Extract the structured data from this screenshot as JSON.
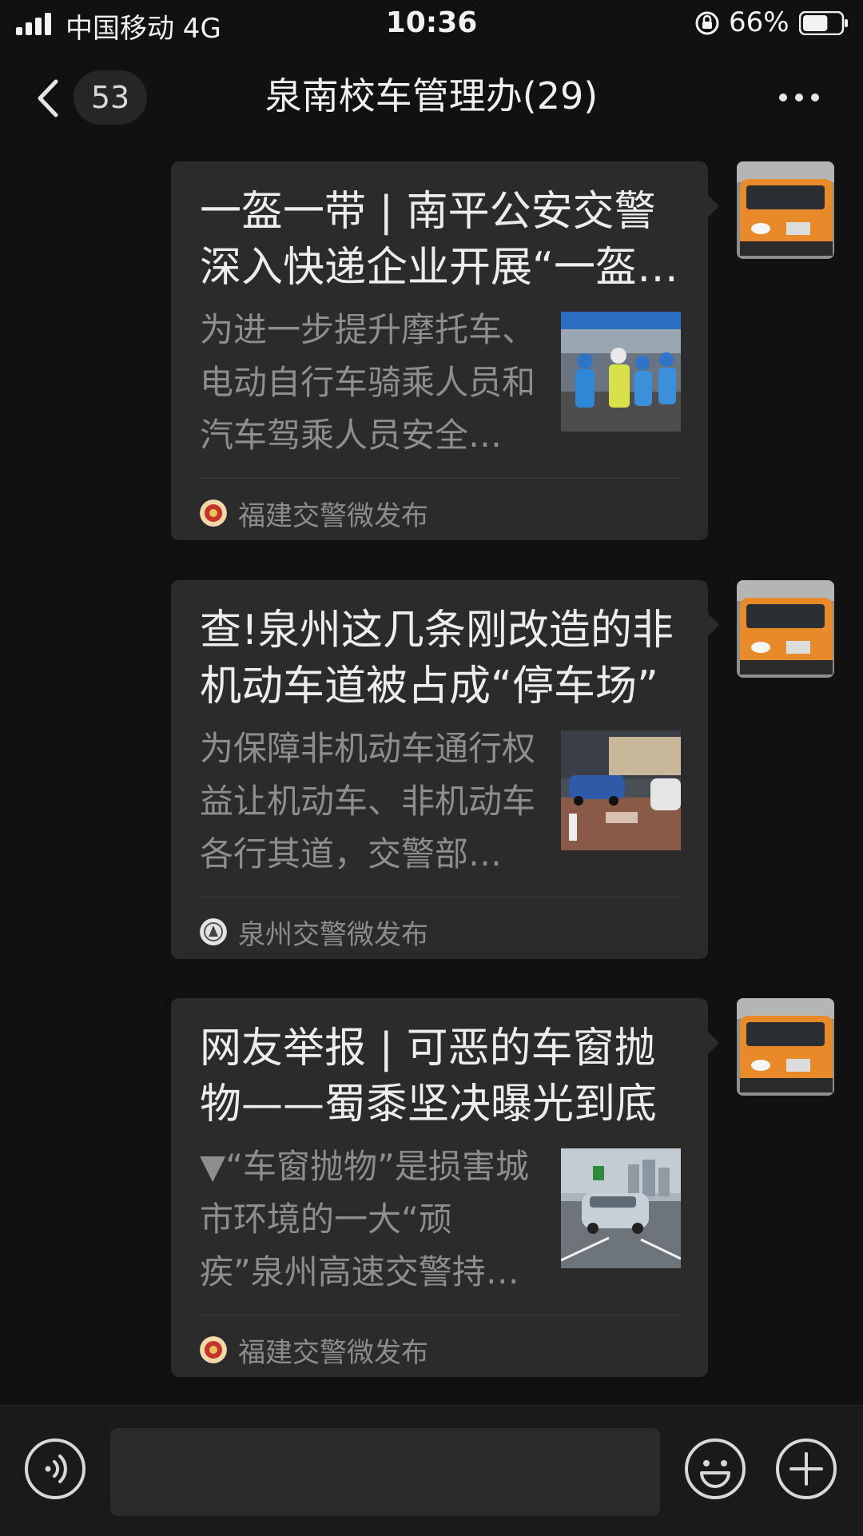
{
  "status_bar": {
    "carrier": "中国移动  4G",
    "time": "10:36",
    "battery_percent": "66%",
    "battery_level": 0.66
  },
  "nav": {
    "unread_count": "53",
    "title": "泉南校车管理办(29)"
  },
  "messages": [
    {
      "title": "一盔一带 | 南平公安交警深入快递企业开展“一盔一带”安全守护行动",
      "description": "为进一步提升摩托车、电动自行车骑乘人员和汽车驾乘人员安全防护意识",
      "source": "福建交警微发布",
      "thumbnail_icon": "police-helmet-photo"
    },
    {
      "title": "查!泉州这几条刚改造的非机动车道被占成“停车场”",
      "description": "为保障非机动车通行权益让机动车、非机动车各行其道，交警部门开展整治",
      "source": "泉州交警微发布",
      "thumbnail_icon": "bike-lane-photo"
    },
    {
      "title": "网友举报 | 可恶的车窗抛物——蜀黍坚决曝光到底",
      "description": "▼“车窗抛物”是损害城市环境的一大“顽疾”泉州高速交警持续曝光",
      "source": "福建交警微发布",
      "thumbnail_icon": "highway-car-photo"
    }
  ],
  "colors": {
    "background": "#111111",
    "card": "#2b2b2b",
    "avatar_bus": "#e98a2a"
  }
}
